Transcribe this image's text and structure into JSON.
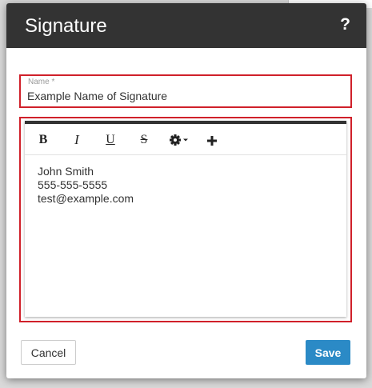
{
  "dialog": {
    "title": "Signature",
    "help_label": "?"
  },
  "name_field": {
    "label": "Name *",
    "value": "Example Name of Signature"
  },
  "toolbar": {
    "bold_label": "B",
    "italic_label": "I",
    "underline_label": "U",
    "strike_label": "S",
    "icons": [
      "bold-icon",
      "italic-icon",
      "underline-icon",
      "strikethrough-icon",
      "gear-dropdown-icon",
      "plus-icon"
    ]
  },
  "editor": {
    "lines": [
      "John Smith",
      "555-555-5555",
      "test@example.com"
    ]
  },
  "footer": {
    "cancel_label": "Cancel",
    "save_label": "Save"
  },
  "colors": {
    "header_bg": "#333333",
    "accent": "#2b8ac6",
    "highlight_border": "#d0202a"
  }
}
